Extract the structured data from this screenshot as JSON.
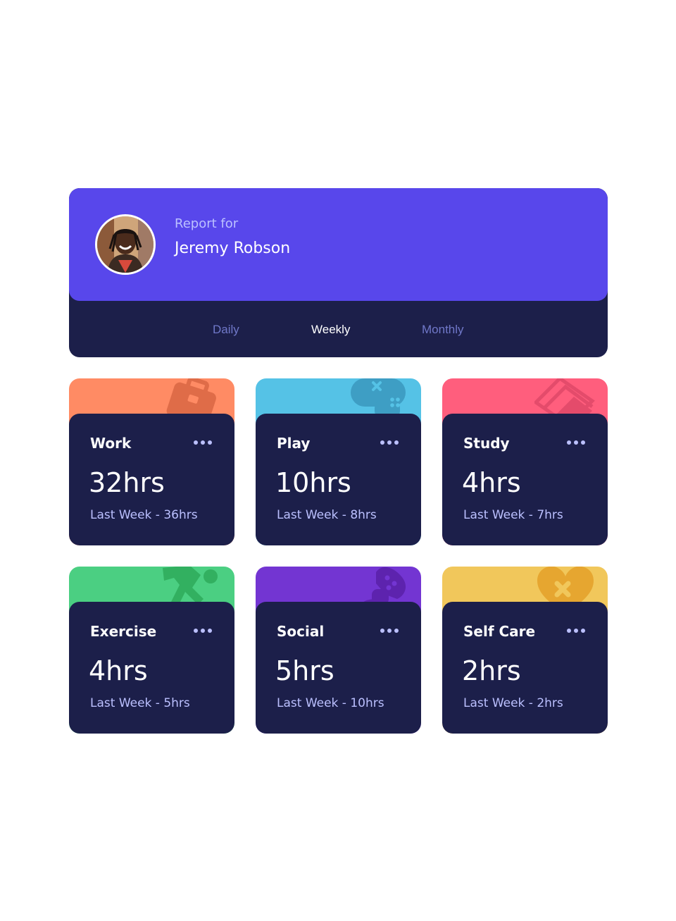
{
  "profile": {
    "report_label": "Report for",
    "name": "Jeremy Robson"
  },
  "tabs": [
    {
      "label": "Daily",
      "active": false
    },
    {
      "label": "Weekly",
      "active": true
    },
    {
      "label": "Monthly",
      "active": false
    }
  ],
  "activities": [
    {
      "title": "Work",
      "hours": "32hrs",
      "previous": "Last Week - 36hrs",
      "color": "#ff8b64",
      "icon": "briefcase-icon"
    },
    {
      "title": "Play",
      "hours": "10hrs",
      "previous": "Last Week - 8hrs",
      "color": "#55c2e6",
      "icon": "gamepad-icon"
    },
    {
      "title": "Study",
      "hours": "4hrs",
      "previous": "Last Week - 7hrs",
      "color": "#ff5e7d",
      "icon": "book-icon"
    },
    {
      "title": "Exercise",
      "hours": "4hrs",
      "previous": "Last Week - 5hrs",
      "color": "#4bcf82",
      "icon": "running-icon"
    },
    {
      "title": "Social",
      "hours": "5hrs",
      "previous": "Last Week - 10hrs",
      "color": "#7335d2",
      "icon": "social-icon"
    },
    {
      "title": "Self Care",
      "hours": "2hrs",
      "previous": "Last Week - 2hrs",
      "color": "#f1c75b",
      "icon": "heart-icon"
    }
  ],
  "colors": {
    "profile_bg": "#5847eb",
    "card_body": "#1c1f4a",
    "muted_text": "#bbc0ff",
    "inactive_tab": "#7078c9",
    "page_bg": "#ffffff"
  }
}
